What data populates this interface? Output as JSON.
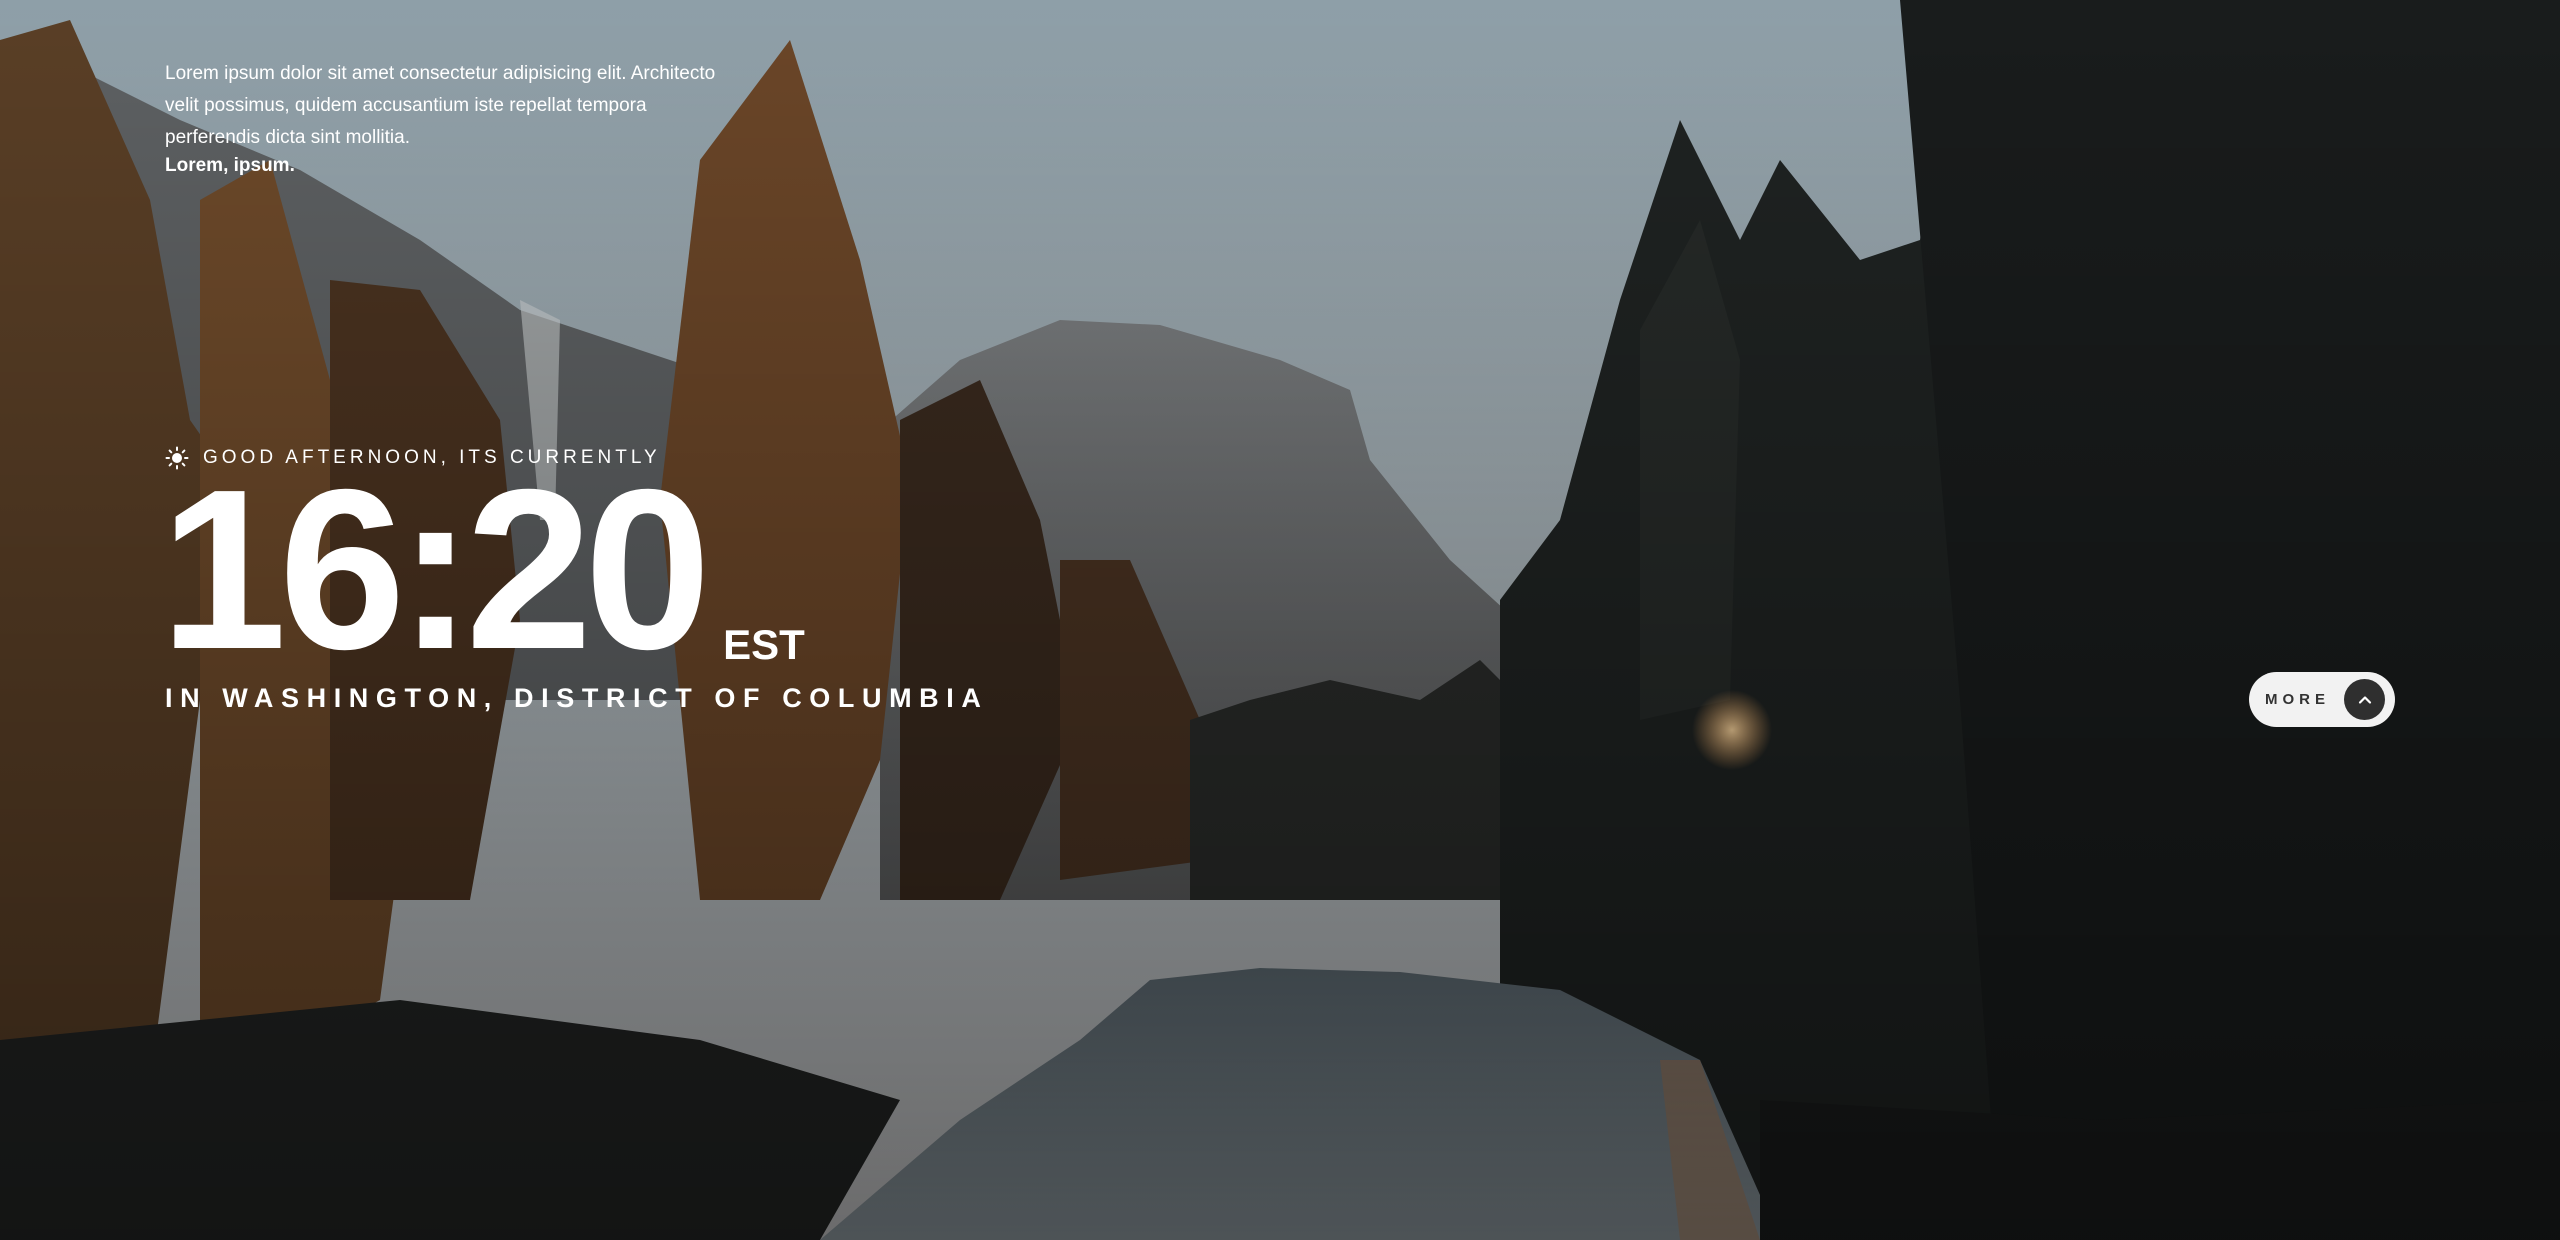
{
  "quote": {
    "text": "Lorem ipsum dolor sit amet consectetur adipisicing elit. Architecto velit possimus, quidem accusantium iste repellat tempora perferendis dicta sint mollitia.",
    "author": "Lorem, ipsum."
  },
  "greeting": {
    "icon": "sun-icon",
    "text": "GOOD AFTERNOON, ITS CURRENTLY"
  },
  "clock": {
    "time": "16:20",
    "timezone": "EST"
  },
  "location": {
    "text": "IN WASHINGTON, DISTRICT OF COLUMBIA"
  },
  "more_button": {
    "label": "MORE",
    "icon": "chevron-up-icon"
  },
  "colors": {
    "sky": "#a4b2b8",
    "forest_dark": "#1b1e1f",
    "button_bg": "#f2f2f2",
    "button_icon_bg": "#2f2f2f"
  }
}
